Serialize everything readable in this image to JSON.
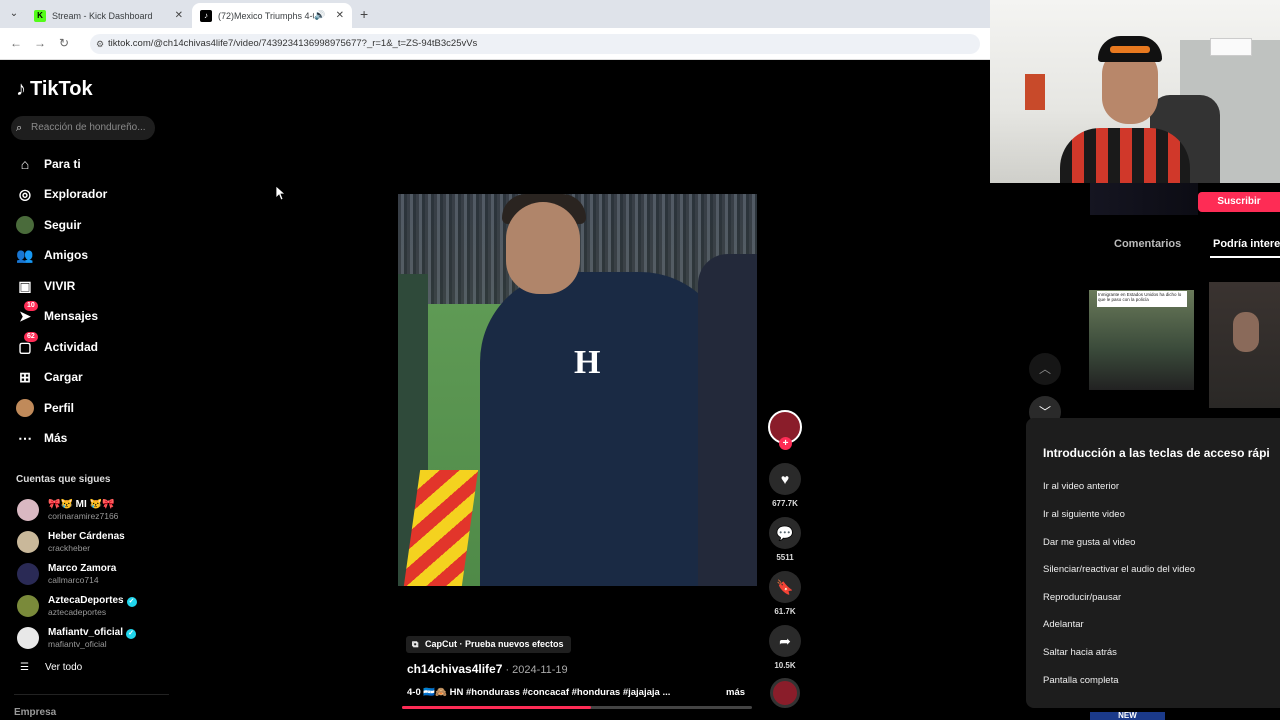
{
  "browser": {
    "tabs": [
      {
        "title": "Stream - Kick Dashboard",
        "favicon": "kick-icon",
        "color": "#53fc18"
      },
      {
        "title": "(72)Mexico Triumphs 4-0 O",
        "favicon": "tiktok-icon",
        "color": "#000000"
      }
    ],
    "url": "tiktok.com/@ch14chivas4life7/video/7439234136998975677?_r=1&_t=ZS-94tB3c25vVs"
  },
  "sidebar": {
    "logo": "TikTok",
    "search_placeholder": "Reacción de hondureño...",
    "nav": [
      {
        "label": "Para ti",
        "icon": "home-icon"
      },
      {
        "label": "Explorador",
        "icon": "compass-icon"
      },
      {
        "label": "Seguir",
        "icon": "following-avatar-icon"
      },
      {
        "label": "Amigos",
        "icon": "friends-icon"
      },
      {
        "label": "VIVIR",
        "icon": "live-icon"
      },
      {
        "label": "Mensajes",
        "icon": "messages-icon",
        "badge": "10"
      },
      {
        "label": "Actividad",
        "icon": "activity-icon",
        "badge": "62"
      },
      {
        "label": "Cargar",
        "icon": "upload-icon"
      },
      {
        "label": "Perfil",
        "icon": "profile-icon"
      },
      {
        "label": "Más",
        "icon": "more-icon"
      }
    ],
    "following_title": "Cuentas que sigues",
    "following": [
      {
        "name": "🎀😿 MI 😿🎀",
        "handle": "corinaramirez7166",
        "color": "#d9b8c2",
        "verified": false
      },
      {
        "name": "Heber Cárdenas",
        "handle": "crackheber",
        "color": "#c9b89a",
        "verified": false
      },
      {
        "name": "Marco Zamora",
        "handle": "callmarco714",
        "color": "#2a2a55",
        "verified": false
      },
      {
        "name": "AztecaDeportes",
        "handle": "aztecadeportes",
        "color": "#7a8a3a",
        "verified": true
      },
      {
        "name": "Mafiantv_oficial",
        "handle": "mafiantv_oficial",
        "color": "#e8e8e8",
        "verified": true
      }
    ],
    "see_all": "Ver todo",
    "company": "Empresa"
  },
  "video": {
    "capcut": "CapCut · Prueba nuevos efectos",
    "author": "ch14chivas4life7",
    "date": " · 2024-11-19",
    "caption": "4-0 🇭🇳🙈 HN #hondurass #concacaf #honduras #jajajaja ...",
    "more": "más",
    "progress": 0.54,
    "shirt_letter": "H",
    "actions": {
      "likes": "677.7K",
      "comments": "5511",
      "saves": "61.7K",
      "shares": "10.5K"
    }
  },
  "right": {
    "subscribe": "Suscribir",
    "tabs": [
      "Comentarios",
      "Podría interes"
    ],
    "thumb_caption": "Inmigrante en Estados Unidos ha dicho lo que le paso con la policía",
    "shortcuts_title": "Introducción a las teclas de acceso rápi",
    "shortcuts": [
      "Ir al video anterior",
      "Ir al siguiente video",
      "Dar me gusta al video",
      "Silenciar/reactivar el audio del video",
      "Reproducir/pausar",
      "Adelantar",
      "Saltar hacia atrás",
      "Pantalla completa"
    ],
    "bottom_label": "NEW"
  },
  "colors": {
    "accent": "#fe2c55",
    "verified": "#20d5ec"
  }
}
